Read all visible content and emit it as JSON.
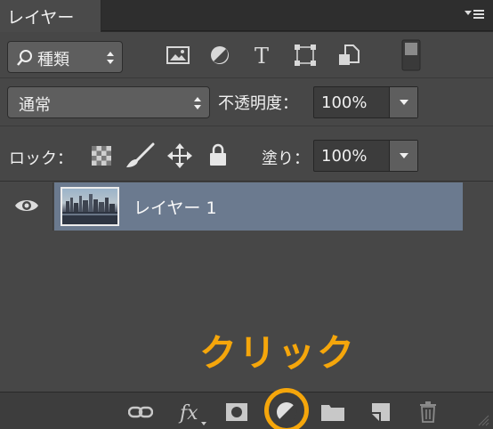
{
  "tab": {
    "label": "レイヤー"
  },
  "filter": {
    "kind_label": "種類"
  },
  "blend": {
    "mode": "通常",
    "opacity_label": "不透明度：",
    "opacity_value": "100%"
  },
  "lock": {
    "label": "ロック：",
    "fill_label": "塗り：",
    "fill_value": "100%"
  },
  "layers": [
    {
      "name": "レイヤー 1",
      "visible": true,
      "selected": true
    }
  ],
  "bottom_icons": [
    "link-icon",
    "fx-icon",
    "mask-icon",
    "adjustment-icon",
    "folder-icon",
    "new-layer-icon",
    "trash-icon"
  ],
  "annotation": {
    "text": "クリック",
    "color": "#f5a60b"
  },
  "colors": {
    "panel_bg": "#474747",
    "selected_layer": "#6b7a8f",
    "highlight": "#f5a60b"
  }
}
